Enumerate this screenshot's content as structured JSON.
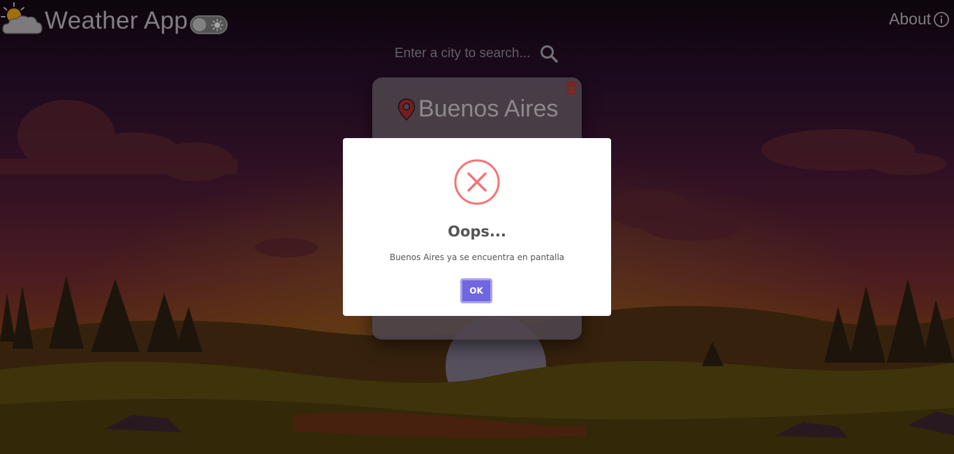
{
  "header": {
    "app_title": "Weather App",
    "about_label": "About"
  },
  "search": {
    "placeholder": "Enter a city to search..."
  },
  "city_card": {
    "city_name": "Buenos Aires"
  },
  "dialog": {
    "title": "Oops...",
    "message": "Buenos Aires ya se encuentra en pantalla",
    "ok_label": "OK"
  },
  "icons": {
    "logo": "sun-behind-cloud-icon",
    "theme_toggle": "sun-icon",
    "about": "info-circle-icon",
    "search": "search-icon",
    "location": "map-pin-icon",
    "delete": "trash-icon",
    "dialog": "error-x-circle-icon"
  },
  "colors": {
    "accent": "#7066e0",
    "error": "#f27474",
    "delete": "#c0392b",
    "pin": "#b3282d"
  }
}
